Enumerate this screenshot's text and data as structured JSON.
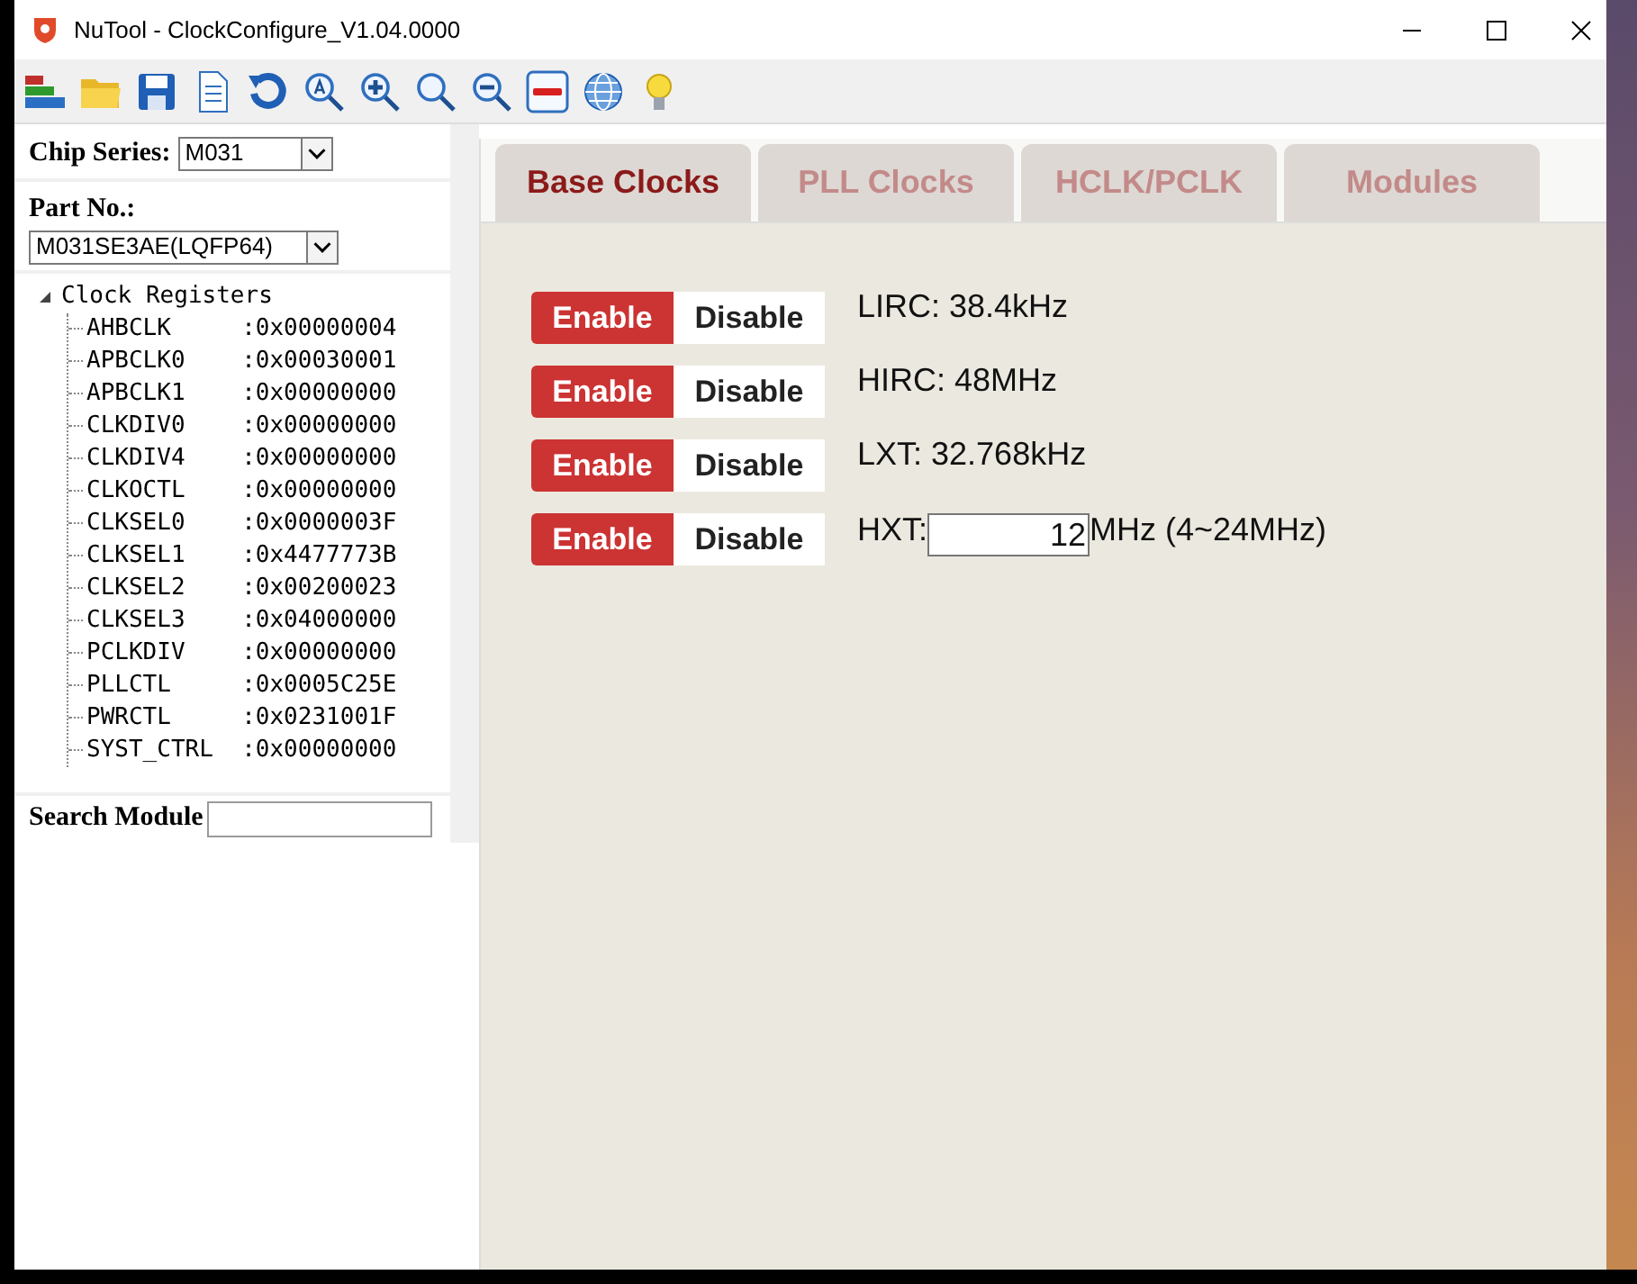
{
  "window": {
    "title": "NuTool - ClockConfigure_V1.04.0000"
  },
  "sidebar": {
    "chip_series": {
      "label": "Chip Series:",
      "value": "M031"
    },
    "part_no": {
      "label": "Part No.:",
      "value": "M031SE3AE(LQFP64)"
    },
    "tree": {
      "label": "Clock Registers",
      "expanded": true,
      "children": [
        {
          "name": "AHBCLK",
          "value": ":0x00000004"
        },
        {
          "name": "APBCLK0",
          "value": ":0x00030001"
        },
        {
          "name": "APBCLK1",
          "value": ":0x00000000"
        },
        {
          "name": "CLKDIV0",
          "value": ":0x00000000"
        },
        {
          "name": "CLKDIV4",
          "value": ":0x00000000"
        },
        {
          "name": "CLKOCTL",
          "value": ":0x00000000"
        },
        {
          "name": "CLKSEL0",
          "value": ":0x0000003F"
        },
        {
          "name": "CLKSEL1",
          "value": ":0x4477773B"
        },
        {
          "name": "CLKSEL2",
          "value": ":0x00200023"
        },
        {
          "name": "CLKSEL3",
          "value": ":0x04000000"
        },
        {
          "name": "PCLKDIV",
          "value": ":0x00000000"
        },
        {
          "name": "PLLCTL",
          "value": ":0x0005C25E"
        },
        {
          "name": "PWRCTL",
          "value": ":0x0231001F"
        },
        {
          "name": "SYST_CTRL",
          "value": ":0x00000000"
        }
      ]
    },
    "search": {
      "label": "Search Module"
    }
  },
  "tabs": [
    {
      "label": "Base Clocks",
      "selected": true
    },
    {
      "label": "PLL Clocks",
      "selected": false
    },
    {
      "label": "HCLK/PCLK",
      "selected": false
    },
    {
      "label": "Modules",
      "selected": false
    }
  ],
  "clocks": [
    {
      "kind": "text",
      "enable": "Enable",
      "disable": "Disable",
      "enabled": true,
      "label": "LIRC: 38.4kHz"
    },
    {
      "kind": "text",
      "enable": "Enable",
      "disable": "Disable",
      "enabled": true,
      "label": "HIRC: 48MHz"
    },
    {
      "kind": "text",
      "enable": "Enable",
      "disable": "Disable",
      "enabled": true,
      "label": "LXT: 32.768kHz"
    },
    {
      "kind": "input",
      "enable": "Enable",
      "disable": "Disable",
      "enabled": true,
      "label": "HXT:",
      "value": "12",
      "unit": "MHz (4~24MHz)"
    }
  ]
}
